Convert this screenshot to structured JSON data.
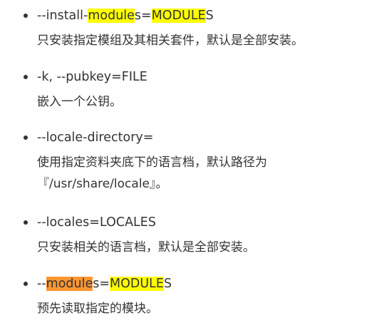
{
  "options": [
    {
      "term": {
        "prefix": "--install-",
        "hl1": "module",
        "mid": "s=",
        "hl2": "MODULE",
        "suffix": "S"
      },
      "desc": [
        "只安装指定模组及其相关套件，默认是全部安装。"
      ]
    },
    {
      "term": {
        "text": "-k, --pubkey=FILE"
      },
      "desc": [
        "嵌入一个公钥。"
      ]
    },
    {
      "term": {
        "text": "--locale-directory="
      },
      "desc": [
        "使用指定资料夹底下的语言档，默认路径为",
        "『/usr/share/locale』。"
      ]
    },
    {
      "term": {
        "text": "--locales=LOCALES"
      },
      "desc": [
        "只安装相关的语言档，默认是全部安装。"
      ]
    },
    {
      "term": {
        "prefix": "--",
        "hl1": "module",
        "mid": "s=",
        "hl2": "MODULE",
        "suffix": "S"
      },
      "desc": [
        "预先读取指定的模块。"
      ]
    }
  ],
  "colors": {
    "text": "#333333",
    "highlight": "#ffff00",
    "highlight_current": "#ff9632"
  }
}
